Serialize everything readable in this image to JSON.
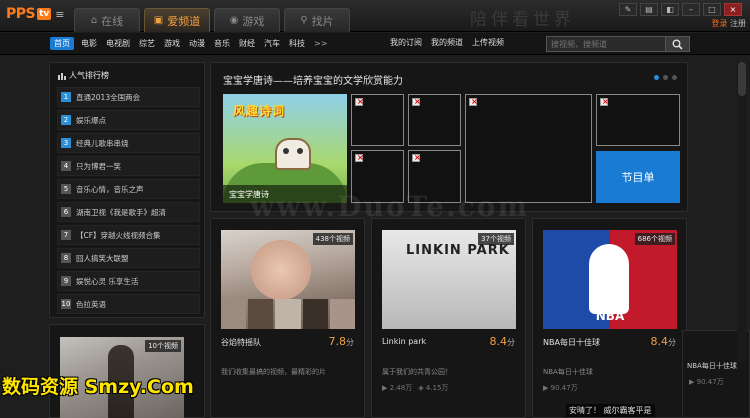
{
  "app": {
    "logo_text": "PPS",
    "logo_badge": "tv",
    "calligraphy": "陪伴看世界",
    "login": "登录",
    "register": "注册"
  },
  "tabs": [
    {
      "label": "在线",
      "icon": "house-icon"
    },
    {
      "label": "爱频道",
      "icon": "tv-icon"
    },
    {
      "label": "游戏",
      "icon": "gamepad-icon"
    },
    {
      "label": "找片",
      "icon": "magnifier-icon"
    }
  ],
  "active_tab": 1,
  "nav": {
    "items": [
      "首页",
      "电影",
      "电视剧",
      "综艺",
      "游戏",
      "动漫",
      "音乐",
      "财经",
      "汽车",
      "科技"
    ],
    "more": ">>",
    "right_items": [
      "我的订阅",
      "我的频道",
      "上传视频"
    ],
    "search_placeholder": "搜视频，搜频道"
  },
  "rank": {
    "title": "人气排行榜",
    "items": [
      "直通2013全国两会",
      "娱乐爆点",
      "经典儿歌串串烧",
      "只为博君一笑",
      "音乐心情，音乐之声",
      "湖南卫视《我是歌手》超清",
      "【CF】穿越火线视频合集",
      "囧人搞笑大联盟",
      "娱悦心灵 乐享生活",
      "色拉英语"
    ]
  },
  "left_card": {
    "badge": "10个视频"
  },
  "carousel": {
    "title": "宝宝学唐诗——培养宝宝的文学欣赏能力",
    "feature_headline": "风趣诗词",
    "feature_caption": "宝宝学唐诗",
    "schedule_button": "节目单"
  },
  "cards": [
    {
      "badge": "438个视频",
      "title": "谷焰特摇队",
      "score": "7.8",
      "unit": "分",
      "desc": "我们收集最搞的视频，最精彩的片",
      "stats": [
        "",
        ""
      ]
    },
    {
      "badge": "37个视频",
      "title": "Linkin park",
      "score": "8.4",
      "unit": "分",
      "image_text": "LINKIN PARK",
      "desc": "属于我们的共青公园！",
      "stats": [
        "2.48万",
        "4.15万"
      ]
    },
    {
      "badge": "686个视频",
      "title": "NBA每日十佳球",
      "score": "8.4",
      "unit": "分",
      "image_text": "NBA",
      "desc": "NBA每日十佳球",
      "stats": [
        "90.47万",
        ""
      ]
    }
  ],
  "right_card": {
    "title": "NBA每日十佳球",
    "stat": "90.47万"
  },
  "overlay": {
    "watermark": "www.DuoTe.com",
    "bottom_watermark": "数码资源 Smzy.Com",
    "tip": "安晴了！ 威尔霸客平是"
  }
}
